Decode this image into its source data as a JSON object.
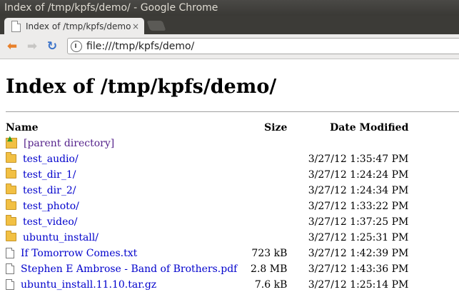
{
  "window": {
    "title": "Index of /tmp/kpfs/demo/ - Google Chrome"
  },
  "tab": {
    "title": "Index of /tmp/kpfs/demo",
    "close": "×"
  },
  "toolbar": {
    "back": "⬅",
    "forward": "➡",
    "reload": "↻",
    "url": "file:///tmp/kpfs/demo/"
  },
  "page": {
    "heading": "Index of /tmp/kpfs/demo/",
    "columns": {
      "name": "Name",
      "size": "Size",
      "date": "Date Modified"
    },
    "parent": "[parent directory]",
    "rows": [
      {
        "name": "test_audio/",
        "size": "",
        "date": "3/27/12 1:35:47 PM",
        "type": "folder"
      },
      {
        "name": "test_dir_1/",
        "size": "",
        "date": "3/27/12 1:24:24 PM",
        "type": "folder"
      },
      {
        "name": "test_dir_2/",
        "size": "",
        "date": "3/27/12 1:24:34 PM",
        "type": "folder"
      },
      {
        "name": "test_photo/",
        "size": "",
        "date": "3/27/12 1:33:22 PM",
        "type": "folder"
      },
      {
        "name": "test_video/",
        "size": "",
        "date": "3/27/12 1:37:25 PM",
        "type": "folder"
      },
      {
        "name": "ubuntu_install/",
        "size": "",
        "date": "3/27/12 1:25:31 PM",
        "type": "folder"
      },
      {
        "name": "If Tomorrow Comes.txt",
        "size": "723 kB",
        "date": "3/27/12 1:42:39 PM",
        "type": "file"
      },
      {
        "name": "Stephen E Ambrose - Band of Brothers.pdf",
        "size": "2.8 MB",
        "date": "3/27/12 1:43:36 PM",
        "type": "file"
      },
      {
        "name": "ubuntu_install.11.10.tar.gz",
        "size": "7.6 kB",
        "date": "3/27/12 1:25:14 PM",
        "type": "file"
      }
    ]
  }
}
